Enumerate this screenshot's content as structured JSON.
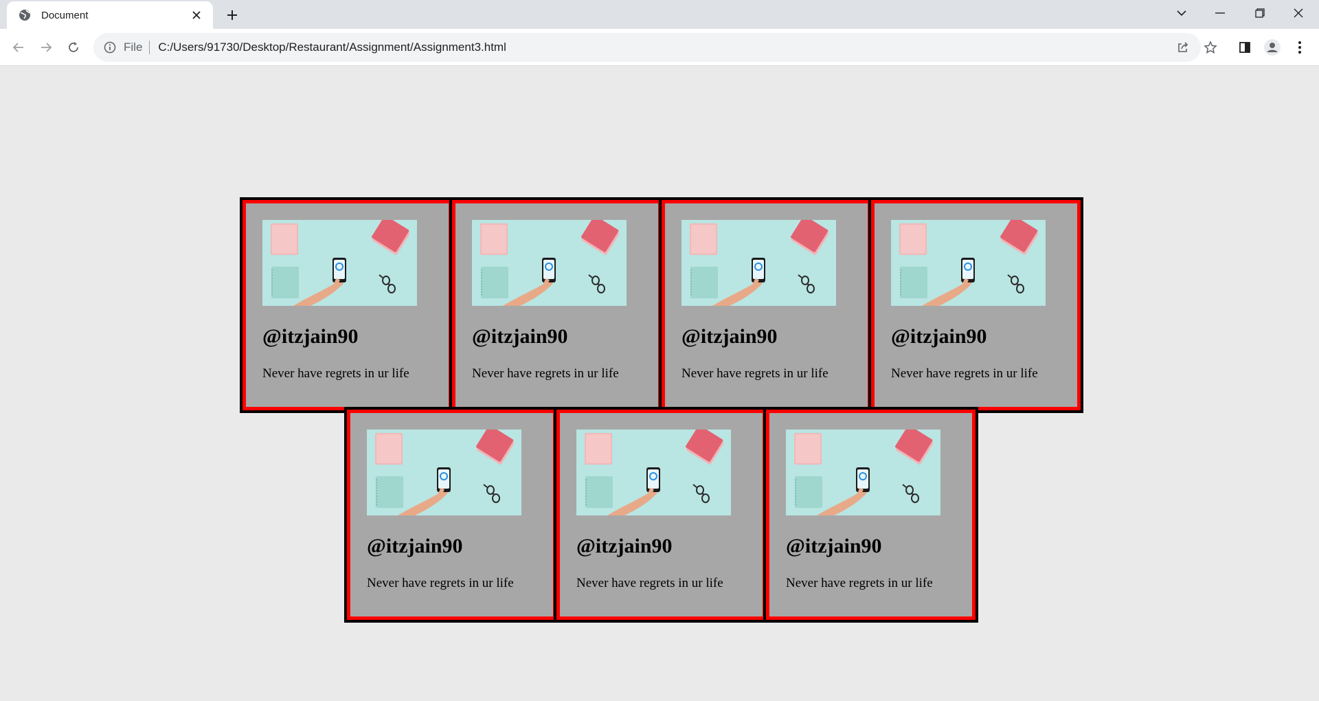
{
  "browser": {
    "tab_title": "Document",
    "address_scheme_label": "File",
    "url": "C:/Users/91730/Desktop/Restaurant/Assignment/Assignment3.html"
  },
  "page": {
    "cards": [
      {
        "handle": "@itzjain90",
        "text": "Never have regrets in ur life"
      },
      {
        "handle": "@itzjain90",
        "text": "Never have regrets in ur life"
      },
      {
        "handle": "@itzjain90",
        "text": "Never have regrets in ur life"
      },
      {
        "handle": "@itzjain90",
        "text": "Never have regrets in ur life"
      },
      {
        "handle": "@itzjain90",
        "text": "Never have regrets in ur life"
      },
      {
        "handle": "@itzjain90",
        "text": "Never have regrets in ur life"
      },
      {
        "handle": "@itzjain90",
        "text": "Never have regrets in ur life"
      }
    ]
  },
  "colors": {
    "card_background": "#a7a7a7",
    "card_border_inner": "#ff0000",
    "card_border_outer": "#000000",
    "page_background": "#eaeaea"
  },
  "icons": {
    "tab": "globe-icon",
    "close": "close-icon",
    "new_tab": "plus-icon",
    "back": "back-arrow-icon",
    "forward": "forward-arrow-icon",
    "reload": "reload-icon",
    "info": "info-icon",
    "share": "share-icon",
    "bookmark": "star-icon",
    "side_panel": "side-panel-icon",
    "profile": "profile-icon",
    "menu": "kebab-menu-icon"
  }
}
